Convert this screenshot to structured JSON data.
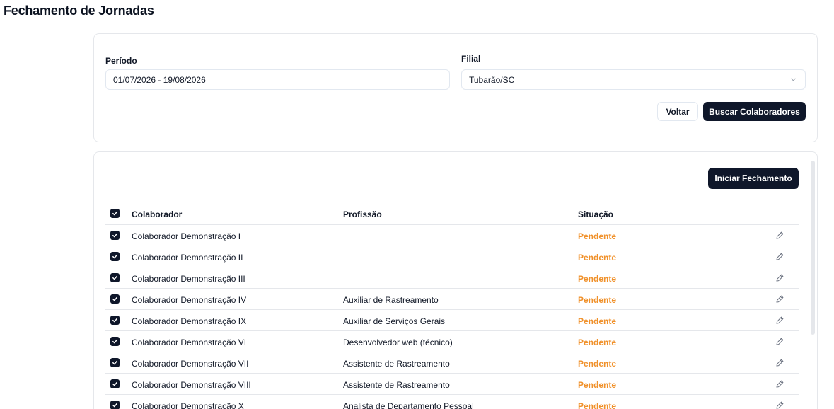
{
  "page": {
    "title": "Fechamento de Jornadas"
  },
  "filters": {
    "periodo_label": "Período",
    "periodo_value": "01/07/2026 - 19/08/2026",
    "filial_label": "Filial",
    "filial_value": "Tubarão/SC",
    "voltar_label": "Voltar",
    "buscar_label": "Buscar Colaboradores"
  },
  "list": {
    "iniciar_label": "Iniciar Fechamento",
    "columns": {
      "colaborador": "Colaborador",
      "profissao": "Profissão",
      "situacao": "Situação"
    },
    "rows": [
      {
        "colaborador": "Colaborador Demonstração I",
        "profissao": "",
        "situacao": "Pendente"
      },
      {
        "colaborador": "Colaborador Demonstração II",
        "profissao": "",
        "situacao": "Pendente"
      },
      {
        "colaborador": "Colaborador Demonstração III",
        "profissao": "",
        "situacao": "Pendente"
      },
      {
        "colaborador": "Colaborador Demonstração IV",
        "profissao": "Auxiliar de Rastreamento",
        "situacao": "Pendente"
      },
      {
        "colaborador": "Colaborador Demonstração IX",
        "profissao": "Auxiliar de Serviços Gerais",
        "situacao": "Pendente"
      },
      {
        "colaborador": "Colaborador Demonstração VI",
        "profissao": "Desenvolvedor web (técnico)",
        "situacao": "Pendente"
      },
      {
        "colaborador": "Colaborador Demonstração VII",
        "profissao": "Assistente de Rastreamento",
        "situacao": "Pendente"
      },
      {
        "colaborador": "Colaborador Demonstração VIII",
        "profissao": "Assistente de Rastreamento",
        "situacao": "Pendente"
      },
      {
        "colaborador": "Colaborador Demonstração X",
        "profissao": "Analista de Departamento Pessoal",
        "situacao": "Pendente"
      }
    ]
  },
  "colors": {
    "status_pending": "#f0912b",
    "primary_dark": "#0f172a"
  },
  "icons": {
    "checkbox": "check-icon",
    "edit": "pencil-icon",
    "select": "chevron-down-icon"
  }
}
